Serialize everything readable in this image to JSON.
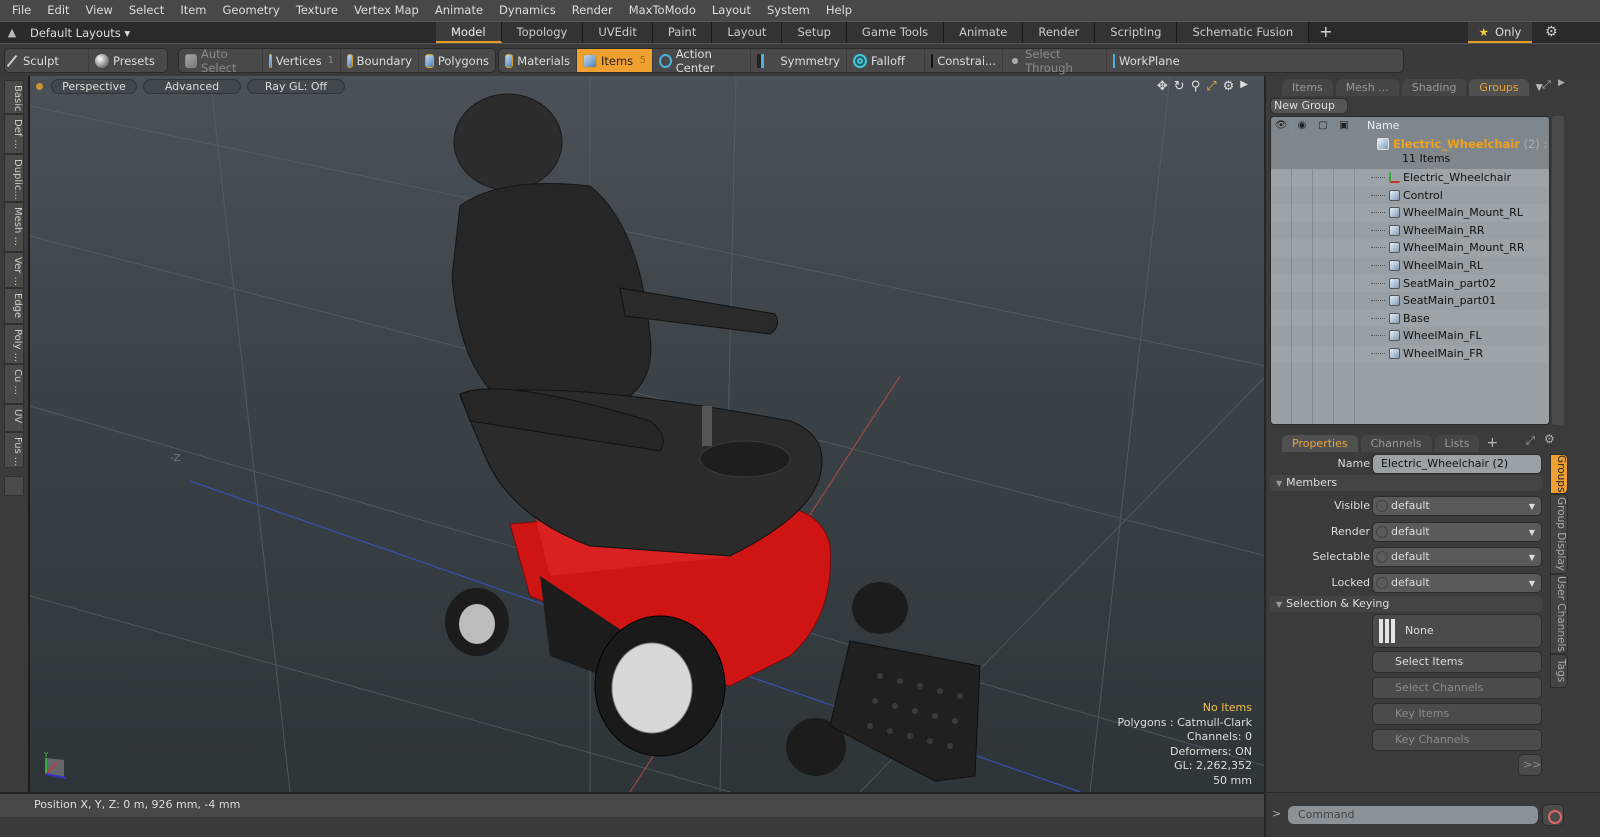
{
  "menu": [
    "File",
    "Edit",
    "View",
    "Select",
    "Item",
    "Geometry",
    "Texture",
    "Vertex Map",
    "Animate",
    "Dynamics",
    "Render",
    "MaxToModo",
    "Layout",
    "System",
    "Help"
  ],
  "layoutbar": {
    "layout_dropdown": "Default Layouts ▾",
    "tabs": [
      "Model",
      "Topology",
      "UVEdit",
      "Paint",
      "Layout",
      "Setup",
      "Game Tools",
      "Animate",
      "Render",
      "Scripting",
      "Schematic Fusion"
    ],
    "active_tab": "Model",
    "add_tab": "+",
    "only_label": "Only"
  },
  "toolbar": {
    "sculpt": "Sculpt",
    "presets": "Presets",
    "auto_select": "Auto Select",
    "vertices": "Vertices",
    "vertices_count": "1",
    "boundary": "Boundary",
    "polygons": "Polygons",
    "materials": "Materials",
    "items": "Items",
    "items_count": "5",
    "action_center": "Action Center",
    "symmetry": "Symmetry",
    "falloff": "Falloff",
    "constraints": "Constrai...",
    "select_through": "Select Through",
    "workplane": "WorkPlane"
  },
  "left_tabs": [
    "Basic",
    "Def ...",
    "Duplic...",
    "Mesh ...",
    "Ver ...",
    "Edge",
    "Poly ...",
    "Cu ...",
    "UV",
    "Fus ..."
  ],
  "viewport": {
    "view_mode": "Perspective",
    "shading": "Advanced",
    "raygl": "Ray GL: Off",
    "stats": {
      "selection": "No Items",
      "polygons": "Polygons : Catmull-Clark",
      "channels": "Channels: 0",
      "deformers": "Deformers: ON",
      "gl": "GL: 2,262,352",
      "scale": "50 mm"
    },
    "axis_labels": {
      "y": "Y",
      "x": "X",
      "z": "Z"
    }
  },
  "status": {
    "position": "Position X, Y, Z:   0 m, 926 mm, -4 mm"
  },
  "groups_panel": {
    "tabs": [
      "Items",
      "Mesh ...",
      "Shading",
      "Groups"
    ],
    "active_tab": "Groups",
    "new_group": "New Group",
    "column_name": "Name",
    "group": {
      "name": "Electric_Wheelchair",
      "count": " (2) :",
      "subtitle": "11 Items"
    },
    "items": [
      {
        "name": "Electric_Wheelchair",
        "type": "locator"
      },
      {
        "name": "Control",
        "type": "mesh"
      },
      {
        "name": "WheelMain_Mount_RL",
        "type": "mesh"
      },
      {
        "name": "WheelMain_RR",
        "type": "mesh"
      },
      {
        "name": "WheelMain_Mount_RR",
        "type": "mesh"
      },
      {
        "name": "WheelMain_RL",
        "type": "mesh"
      },
      {
        "name": "SeatMain_part02",
        "type": "mesh"
      },
      {
        "name": "SeatMain_part01",
        "type": "mesh"
      },
      {
        "name": "Base",
        "type": "mesh"
      },
      {
        "name": "WheelMain_FL",
        "type": "mesh"
      },
      {
        "name": "WheelMain_FR",
        "type": "mesh"
      }
    ]
  },
  "properties_panel": {
    "tabs": [
      "Properties",
      "Channels",
      "Lists"
    ],
    "active_tab": "Properties",
    "name_label": "Name",
    "name_value": "Electric_Wheelchair (2)",
    "members_section": "Members",
    "fields": [
      {
        "label": "Visible",
        "value": "default"
      },
      {
        "label": "Render",
        "value": "default"
      },
      {
        "label": "Selectable",
        "value": "default"
      },
      {
        "label": "Locked",
        "value": "default"
      }
    ],
    "selection_section": "Selection & Keying",
    "none_label": "None",
    "select_items": "Select Items",
    "select_channels": "Select Channels",
    "key_items": "Key Items",
    "key_channels": "Key Channels",
    "more": ">>",
    "side_tabs": [
      "Groups",
      "Group Display",
      "User Channels",
      "Tags"
    ],
    "active_side_tab": "Groups"
  },
  "command": {
    "placeholder": "Command",
    "prompt": ">"
  },
  "colors": {
    "accent": "#f0a030",
    "group_name": "#f2a21a",
    "warning_text": "#f2c04a",
    "wheelchair_base": "#d81818",
    "seat": "#2a2a2a"
  }
}
